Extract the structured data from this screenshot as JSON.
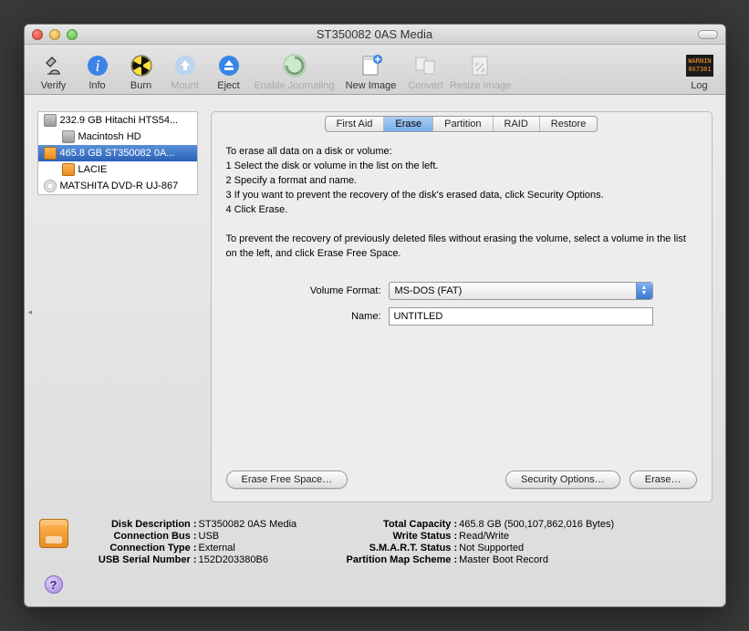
{
  "window": {
    "title": "ST350082 0AS Media"
  },
  "toolbar": {
    "verify": "Verify",
    "info": "Info",
    "burn": "Burn",
    "mount": "Mount",
    "eject": "Eject",
    "enable_journaling": "Enable Journaling",
    "new_image": "New Image",
    "convert": "Convert",
    "resize_image": "Resize Image",
    "log": "Log"
  },
  "sidebar": {
    "items": [
      {
        "label": "232.9 GB Hitachi HTS54...",
        "icon": "disk",
        "indent": false,
        "selected": false
      },
      {
        "label": "Macintosh HD",
        "icon": "disk",
        "indent": true,
        "selected": false
      },
      {
        "label": "465.8 GB ST350082 0A...",
        "icon": "usbdisk",
        "indent": false,
        "selected": true
      },
      {
        "label": "LACIE",
        "icon": "usbdisk",
        "indent": true,
        "selected": false
      },
      {
        "label": "MATSHITA DVD-R UJ-867",
        "icon": "cd",
        "indent": false,
        "selected": false
      }
    ]
  },
  "tabs": {
    "first_aid": "First Aid",
    "erase": "Erase",
    "partition": "Partition",
    "raid": "RAID",
    "restore": "Restore"
  },
  "erase": {
    "intro": "To erase all data on a disk or volume:",
    "step1": "1  Select the disk or volume in the list on the left.",
    "step2": "2  Specify a format and name.",
    "step3": "3  If you want to prevent the recovery of the disk's erased data, click Security Options.",
    "step4": "4  Click Erase.",
    "para2": "To prevent the recovery of previously deleted files without erasing the volume, select a volume in the list on the left, and click Erase Free Space.",
    "volume_format_label": "Volume Format:",
    "volume_format_value": "MS-DOS (FAT)",
    "name_label": "Name:",
    "name_value": "UNTITLED",
    "erase_free_space_btn": "Erase Free Space…",
    "security_options_btn": "Security Options…",
    "erase_btn": "Erase…"
  },
  "footer": {
    "left": {
      "disk_description_k": "Disk Description :",
      "disk_description_v": " ST350082 0AS Media",
      "connection_bus_k": "Connection Bus :",
      "connection_bus_v": " USB",
      "connection_type_k": "Connection Type :",
      "connection_type_v": " External",
      "usb_serial_k": "USB Serial Number :",
      "usb_serial_v": " 152D203380B6"
    },
    "right": {
      "total_capacity_k": "Total Capacity :",
      "total_capacity_v": " 465.8 GB (500,107,862,016 Bytes)",
      "write_status_k": "Write Status :",
      "write_status_v": " Read/Write",
      "smart_status_k": "S.M.A.R.T. Status :",
      "smart_status_v": " Not Supported",
      "partition_scheme_k": "Partition Map Scheme :",
      "partition_scheme_v": " Master Boot Record"
    }
  }
}
